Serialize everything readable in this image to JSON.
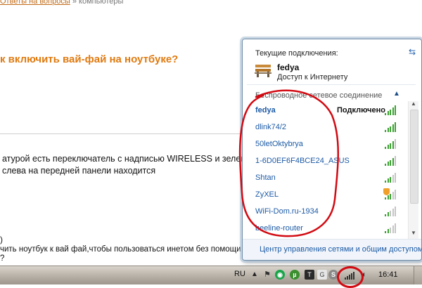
{
  "page": {
    "breadcrumb": {
      "link": "Ответы на вопросы",
      "current": "компьютеры"
    },
    "question_title": "к включить вай-фай на ноутбуке?",
    "answer_line1": "атурой есть переключатель с надписью WIRELESS и зеленый св",
    "answer_line2": "слева на передней панели находится",
    "fragment": ")",
    "tail_line1": "чить ноутбук к вай фай,чтобы пользоваться инетом без помощи сетевог",
    "tail_line2": "?"
  },
  "network_popup": {
    "current_label": "Текущие подключения:",
    "current_connection": {
      "name": "fedya",
      "status": "Доступ к Интернету"
    },
    "section_label": "Беспроводное сетевое соединение",
    "networks": [
      {
        "name": "fedya",
        "status": "Подключено",
        "bars": 5,
        "secured": false,
        "connected": true
      },
      {
        "name": "dlink74/2",
        "status": "",
        "bars": 5,
        "secured": false,
        "connected": false
      },
      {
        "name": "50letOktybrya",
        "status": "",
        "bars": 4,
        "secured": false,
        "connected": false
      },
      {
        "name": "1-6D0EF6F4BCE24_ASUS",
        "status": "",
        "bars": 4,
        "secured": false,
        "connected": false
      },
      {
        "name": "Shtan",
        "status": "",
        "bars": 3,
        "secured": false,
        "connected": false
      },
      {
        "name": "ZyXEL",
        "status": "",
        "bars": 3,
        "secured": true,
        "connected": false
      },
      {
        "name": "WiFi-Dom.ru-1934",
        "status": "",
        "bars": 2,
        "secured": false,
        "connected": false
      },
      {
        "name": "beeline-router",
        "status": "",
        "bars": 2,
        "secured": false,
        "connected": false
      }
    ],
    "footer_link": "Центр управления сетями и общим доступом",
    "refresh_icon": "refresh-icon",
    "collapse_icon": "chevron-up-icon"
  },
  "taskbar": {
    "language": "RU",
    "clock": "16:41",
    "tray_icons": [
      "tray-arrow-icon",
      "action-center-flag-icon",
      "green-app-icon",
      "utorrent-icon",
      "tray-t-icon",
      "tray-g-icon",
      "skype-icon",
      "network-signal-icon",
      "volume-icon"
    ]
  },
  "colors": {
    "signal_green": "#3aa030",
    "signal_grey": "#c4c4c4",
    "link_blue": "#1c5aa5",
    "annotation_red": "#d20a12",
    "title_orange": "#e07a10"
  }
}
